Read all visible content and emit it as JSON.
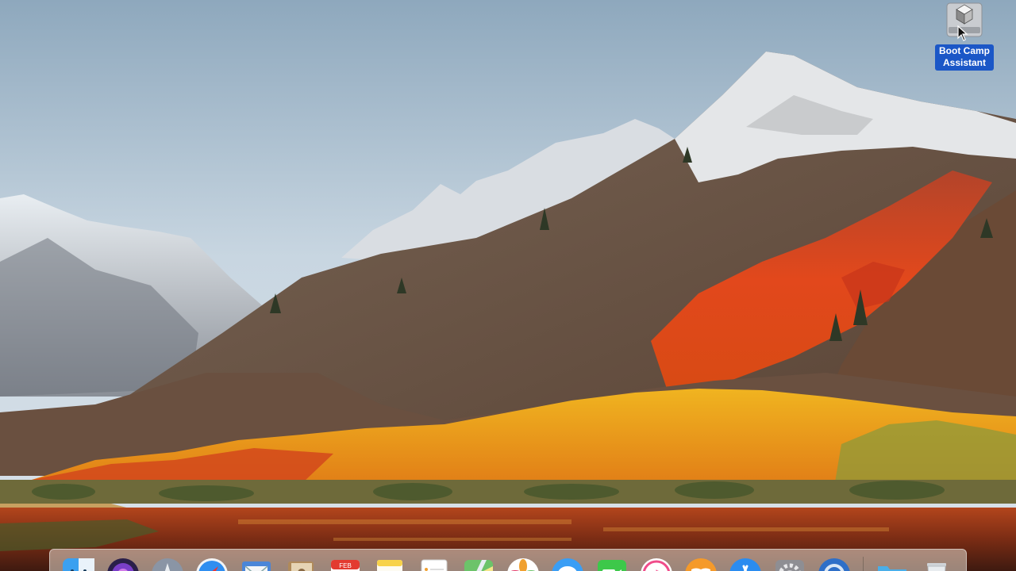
{
  "desktop": {
    "icons": [
      {
        "label": "Boot Camp\nAssistant",
        "line1": "Boot Camp",
        "line2": "Assistant",
        "icon": "boot-camp-drive-icon",
        "selected": true
      }
    ]
  },
  "dock": {
    "apps": [
      {
        "name": "finder",
        "icon": "finder-icon",
        "color": "#3aa0f0"
      },
      {
        "name": "siri",
        "icon": "siri-icon",
        "color": "#7a3fc8"
      },
      {
        "name": "launchpad",
        "icon": "launchpad-icon",
        "color": "#8a95a5"
      },
      {
        "name": "safari",
        "icon": "safari-icon",
        "color": "#2f8ef0"
      },
      {
        "name": "mail",
        "icon": "mail-icon",
        "color": "#4a86d8"
      },
      {
        "name": "contacts",
        "icon": "contacts-icon",
        "color": "#b08a5a"
      },
      {
        "name": "calendar",
        "icon": "calendar-icon",
        "color": "#e33b30",
        "month": "FEB"
      },
      {
        "name": "notes",
        "icon": "notes-icon",
        "color": "#f7d24a"
      },
      {
        "name": "reminders",
        "icon": "reminders-icon",
        "color": "#ffffff"
      },
      {
        "name": "maps",
        "icon": "maps-icon",
        "color": "#6cc36a"
      },
      {
        "name": "photos",
        "icon": "photos-icon",
        "color": "#f0a030"
      },
      {
        "name": "messages",
        "icon": "messages-icon",
        "color": "#3a9ef5"
      },
      {
        "name": "facetime",
        "icon": "facetime-icon",
        "color": "#3dc84a"
      },
      {
        "name": "itunes",
        "icon": "itunes-icon",
        "color": "#f04c8a"
      },
      {
        "name": "ibooks",
        "icon": "ibooks-icon",
        "color": "#f59a2a"
      },
      {
        "name": "app-store",
        "icon": "app-store-icon",
        "color": "#2a8cf0"
      },
      {
        "name": "system-preferences",
        "icon": "gear-icon",
        "color": "#8e8e93"
      },
      {
        "name": "quicktime",
        "icon": "quicktime-icon",
        "color": "#2e6fc8"
      }
    ],
    "stacks": [
      {
        "name": "downloads-folder",
        "icon": "folder-icon",
        "color": "#4aaee8"
      },
      {
        "name": "trash",
        "icon": "trash-icon",
        "color": "#e8ecef"
      }
    ]
  }
}
